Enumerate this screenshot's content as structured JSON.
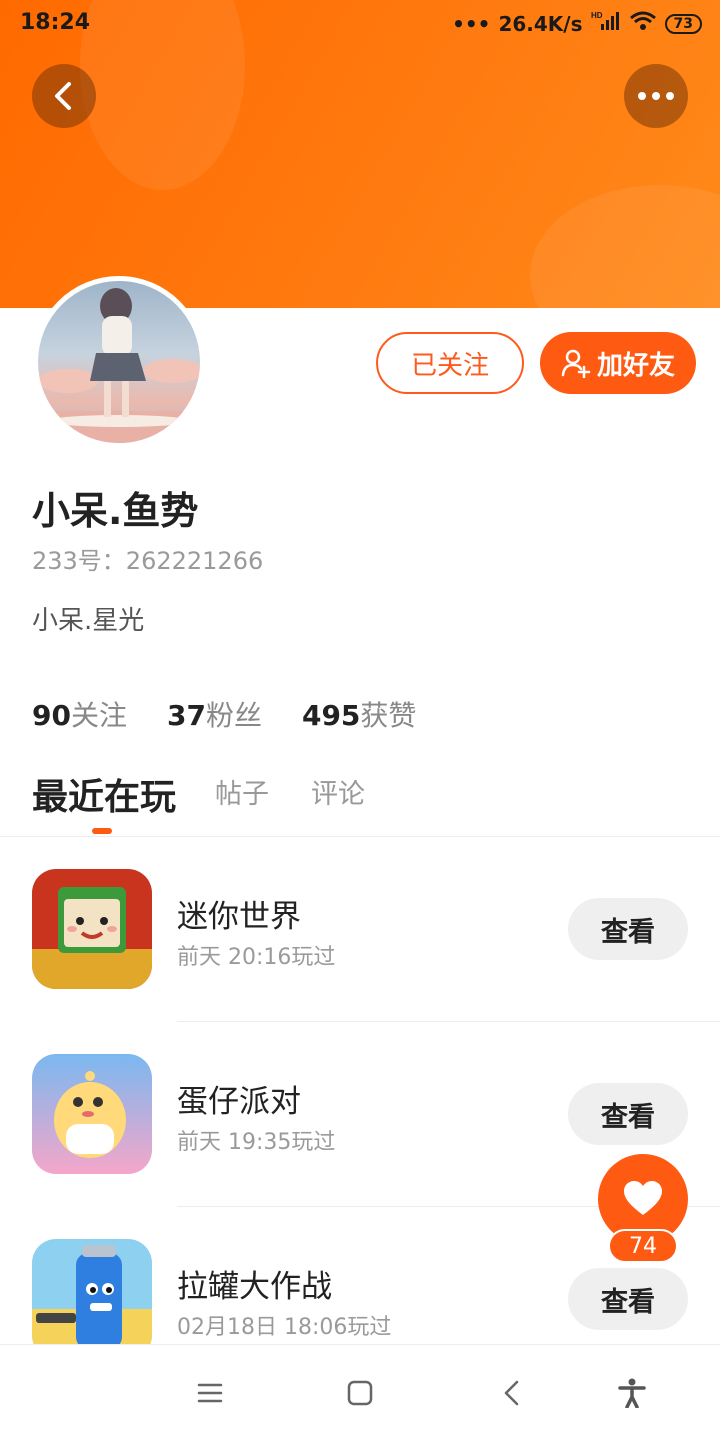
{
  "status_bar": {
    "time": "18:24",
    "network_speed": "26.4K/s",
    "network_type": "HD",
    "battery": "73"
  },
  "header": {
    "back_icon": "chevron-left-icon",
    "more_icon": "more-dots-icon"
  },
  "profile": {
    "name": "小呆.鱼势",
    "id_label": "233号：262221266",
    "bio": "小呆.星光",
    "follow_state_label": "已关注",
    "add_friend_label": "加好友",
    "stats": [
      {
        "count": "90",
        "label": "关注"
      },
      {
        "count": "37",
        "label": "粉丝"
      },
      {
        "count": "495",
        "label": "获赞"
      }
    ]
  },
  "tabs": [
    {
      "label": "最近在玩",
      "active": true
    },
    {
      "label": "帖子",
      "active": false
    },
    {
      "label": "评论",
      "active": false
    }
  ],
  "recent_games": [
    {
      "title": "迷你世界",
      "played": "前天 20:16玩过",
      "button": "查看"
    },
    {
      "title": "蛋仔派对",
      "played": "前天 19:35玩过",
      "button": "查看"
    },
    {
      "title": "拉罐大作战",
      "played": "02月18日 18:06玩过",
      "button": "查看"
    }
  ],
  "like_fab": {
    "count": "74",
    "icon": "heart-icon"
  },
  "colors": {
    "accent": "#ff5a12",
    "header_orange": "#ff7a10"
  }
}
